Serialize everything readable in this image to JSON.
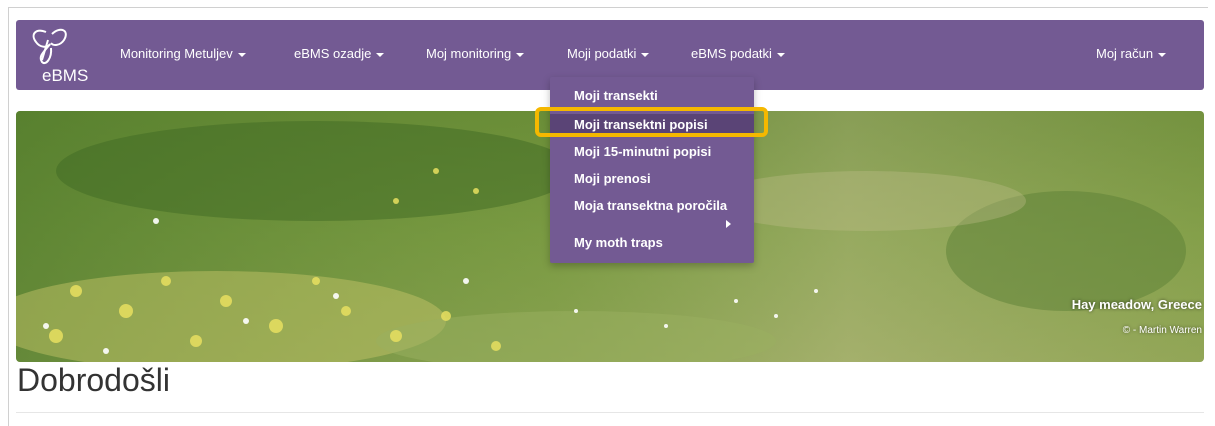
{
  "brand": {
    "logo_text": "eBMS"
  },
  "nav": {
    "items": [
      {
        "label": "Monitoring Metuljev"
      },
      {
        "label": "eBMS ozadje"
      },
      {
        "label": "Moj monitoring"
      },
      {
        "label": "Moji podatki"
      },
      {
        "label": "eBMS podatki"
      }
    ],
    "account": "Moj račun"
  },
  "dropdown": {
    "items": [
      {
        "label": "Moji transekti"
      },
      {
        "label": "Moji transektni popisi",
        "active": true
      },
      {
        "label": "Moji 15-minutni popisi"
      },
      {
        "label": "Moji prenosi"
      },
      {
        "label": "Moja transektna poročila",
        "has_submenu": true
      },
      {
        "label": "My moth traps"
      }
    ]
  },
  "hero": {
    "caption_title": "Hay meadow, Greece",
    "caption_credit": "© - Martin Warren"
  },
  "page": {
    "title": "Dobrodošli"
  },
  "colors": {
    "navbar": "#735a93",
    "dropdown_active": "#5a4476",
    "highlight": "#f5b800"
  }
}
